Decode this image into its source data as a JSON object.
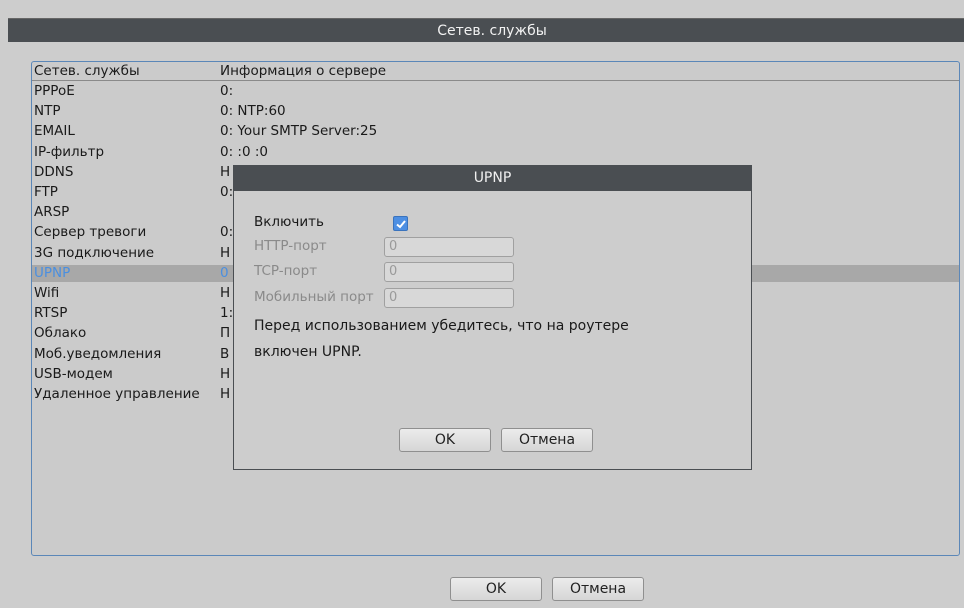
{
  "window": {
    "title": "Сетев. службы"
  },
  "table": {
    "headers": [
      "Сетев. службы",
      "Информация о сервере"
    ],
    "rows": [
      {
        "name": "PPPoE",
        "info": "0:"
      },
      {
        "name": "NTP",
        "info": "0: NTP:60"
      },
      {
        "name": "EMAIL",
        "info": "0: Your SMTP Server:25"
      },
      {
        "name": "IP-фильтр",
        "info": "0: :0 :0"
      },
      {
        "name": "DDNS",
        "info": "Н"
      },
      {
        "name": "FTP",
        "info": "0:"
      },
      {
        "name": "ARSP",
        "info": ""
      },
      {
        "name": "Сервер тревоги",
        "info": "0:"
      },
      {
        "name": "3G подключение",
        "info": "Н"
      },
      {
        "name": "UPNP",
        "info": "0"
      },
      {
        "name": "Wifi",
        "info": "Н"
      },
      {
        "name": "RTSP",
        "info": "1:"
      },
      {
        "name": "Облако",
        "info": "П"
      },
      {
        "name": "Моб.уведомления",
        "info": "В"
      },
      {
        "name": "USB-модем",
        "info": "Н"
      },
      {
        "name": "Удаленное управление",
        "info": "Н"
      }
    ],
    "selected_index": 9
  },
  "footer": {
    "ok_label": "OK",
    "cancel_label": "Отмена"
  },
  "dialog": {
    "title": "UPNP",
    "enable_label": "Включить",
    "enable_checked": true,
    "http_port_label": "HTTP-порт",
    "http_port_value": "0",
    "tcp_port_label": "TCP-порт",
    "tcp_port_value": "0",
    "mobile_port_label": "Мобильный порт",
    "mobile_port_value": "0",
    "note_line1": "Перед использованием убедитесь, что на роутере",
    "note_line2": "включен UPNP.",
    "ok_label": "OK",
    "cancel_label": "Отмена"
  },
  "colors": {
    "title_bar": "#4a4e52",
    "accent": "#4d8fe3",
    "selected_row": "#a8a8a8"
  }
}
